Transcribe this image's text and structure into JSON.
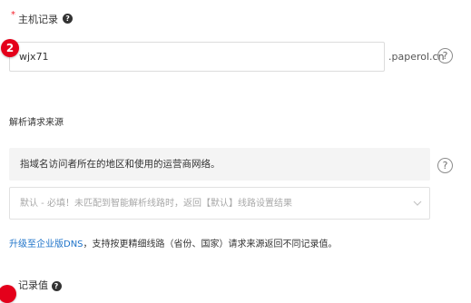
{
  "host_record": {
    "required_mark": "*",
    "label": "主机记录",
    "help_glyph": "?",
    "step_number": "2",
    "value": "wjx71",
    "domain_suffix": ".paperol.cn",
    "help_circle_glyph": "?"
  },
  "resolution_source": {
    "title": "解析请求来源",
    "info_text": "指域名访问者所在的地区和使用的运营商网络。",
    "help_circle_glyph": "?",
    "select_text": "默认 - 必填！未匹配到智能解析线路时，返回【默认】线路设置结果"
  },
  "upgrade": {
    "link_text": "升级至企业版DNS",
    "rest_text": "，支持按更精细线路（省份、国家）请求来源返回不同记录值。"
  },
  "record_value": {
    "label": "记录值",
    "help_glyph": "?"
  },
  "colors": {
    "accent_red": "#e4001b",
    "link_blue": "#1e73c9",
    "required_red": "#f5222d"
  },
  "icons": {
    "step_badge": "numbered-step-marker",
    "select_arrow": "chevron-down-icon",
    "help": "question-circle-icon"
  }
}
